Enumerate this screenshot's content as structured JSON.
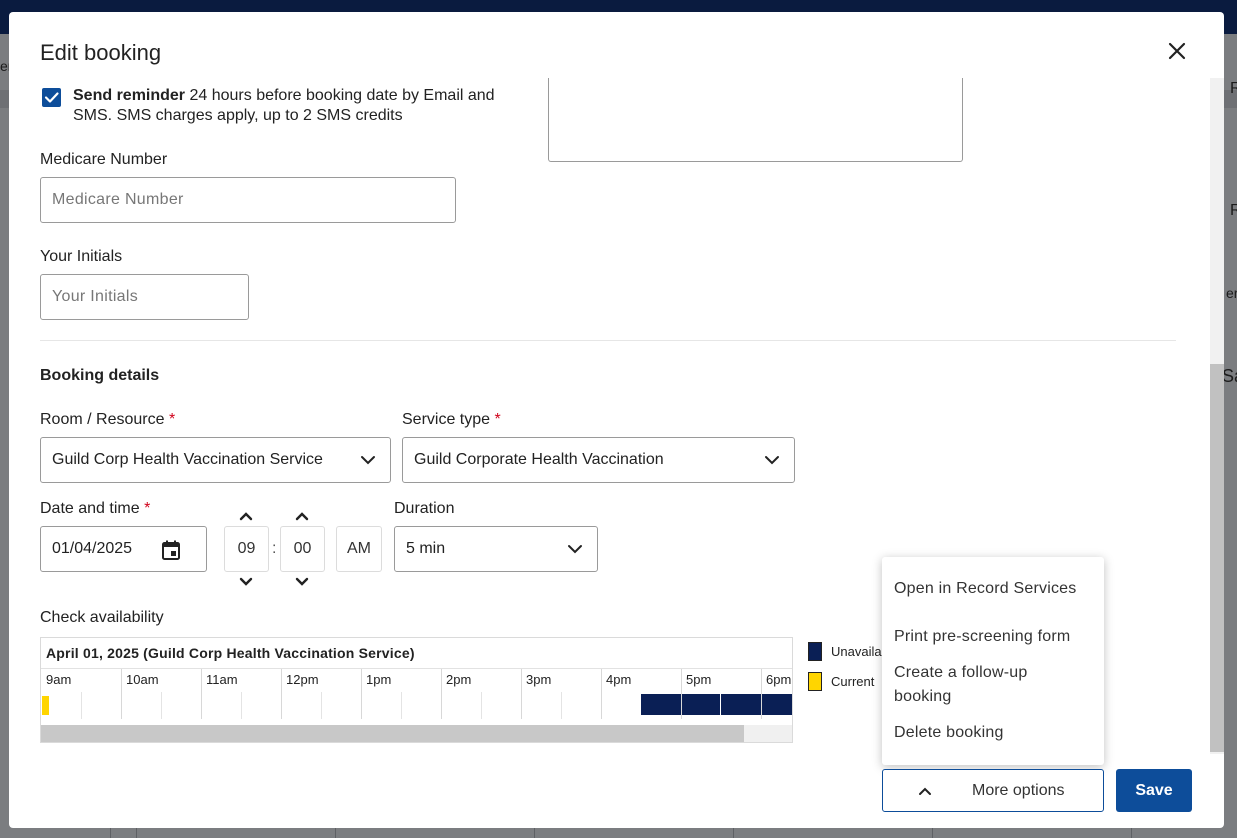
{
  "background": {
    "fragments": [
      "er",
      "R",
      "R",
      "er",
      "Sa"
    ]
  },
  "modal": {
    "title": "Edit booking",
    "reminder": {
      "checked": true,
      "bold": "Send reminder",
      "text": " 24 hours before booking date by Email and SMS. SMS charges apply, up to 2 SMS credits"
    },
    "medicare": {
      "label": "Medicare Number",
      "placeholder": "Medicare Number"
    },
    "initials": {
      "label": "Your Initials",
      "placeholder": "Your Initials"
    },
    "booking_details": {
      "title": "Booking details",
      "room": {
        "label": "Room / Resource",
        "required": "*",
        "value": "Guild Corp Health Vaccination Service"
      },
      "service": {
        "label": "Service type",
        "required": "*",
        "value": "Guild Corporate Health Vaccination"
      },
      "datetime": {
        "label": "Date and time",
        "required": "*",
        "date": "01/04/2025",
        "hour": "09",
        "minute": "00",
        "separator": ":",
        "period": "AM"
      },
      "duration": {
        "label": "Duration",
        "value": "5 min"
      }
    },
    "availability": {
      "label": "Check availability",
      "title": "April 01, 2025 (Guild Corp Health Vaccination Service)",
      "hours": [
        "9am",
        "10am",
        "11am",
        "12pm",
        "1pm",
        "2pm",
        "3pm",
        "4pm",
        "5pm",
        "6pm"
      ],
      "legend": [
        {
          "label": "Unavaila",
          "color": "#0a1f55"
        },
        {
          "label": "Current",
          "color": "#ffd500"
        }
      ]
    },
    "menu": {
      "items": [
        "Open in Record Services",
        "Print pre-screening form",
        "Create a follow-up booking",
        "Delete booking"
      ]
    },
    "buttons": {
      "more_options": "More options",
      "save": "Save"
    }
  },
  "colors": {
    "primary": "#0d4d9a",
    "unavailable": "#0a1f55",
    "current": "#ffd500",
    "required": "#d0021b"
  }
}
